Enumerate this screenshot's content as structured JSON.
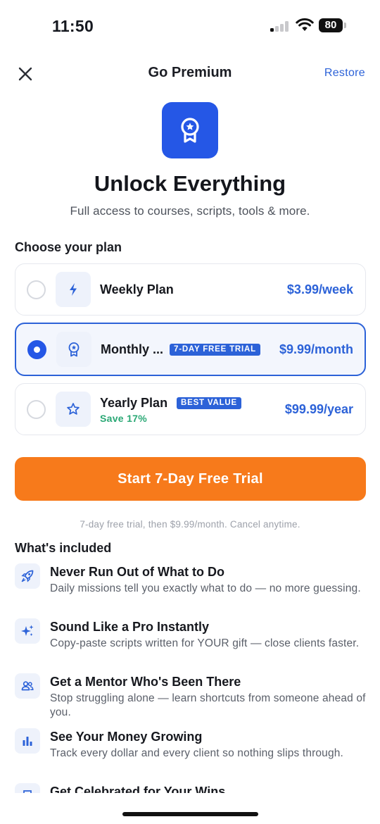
{
  "status_bar": {
    "time": "11:50",
    "battery": "80"
  },
  "header": {
    "title": "Go Premium",
    "restore_label": "Restore",
    "close_icon": "close-icon"
  },
  "hero": {
    "icon": "award-badge-icon",
    "title": "Unlock Everything",
    "subtitle": "Full access to courses, scripts, tools & more."
  },
  "plans_section": {
    "label": "Choose your plan",
    "plans": [
      {
        "name": "Weekly Plan",
        "price": "$3.99/week",
        "icon": "bolt-icon",
        "selected": false
      },
      {
        "name": "Monthly ...",
        "price": "$9.99/month",
        "icon": "award-icon",
        "badge": "7-DAY FREE TRIAL",
        "selected": true
      },
      {
        "name": "Yearly Plan",
        "price": "$99.99/year",
        "icon": "star-icon",
        "badge": "BEST VALUE",
        "note": "Save 17%",
        "selected": false
      }
    ]
  },
  "cta": {
    "label": "Start 7-Day Free Trial",
    "disclaimer": "7-day free trial, then $9.99/month. Cancel anytime."
  },
  "features_section": {
    "label": "What's included",
    "items": [
      {
        "icon": "rocket-icon",
        "title": "Never Run Out of What to Do",
        "desc": "Daily missions tell you exactly what to do — no more guessing."
      },
      {
        "icon": "sparkles-icon",
        "title": "Sound Like a Pro Instantly",
        "desc": "Copy-paste scripts written for YOUR gift — close clients faster."
      },
      {
        "icon": "users-icon",
        "title": "Get a Mentor Who's Been There",
        "desc": "Stop struggling alone — learn shortcuts from someone ahead of you."
      },
      {
        "icon": "bar-chart-icon",
        "title": "See Your Money Growing",
        "desc": "Track every dollar and every client so nothing slips through."
      },
      {
        "icon": "trophy-icon",
        "title": "Get Celebrated for Your Wins",
        "desc": ""
      }
    ]
  },
  "colors": {
    "accent": "#2c62d8",
    "cta": "#f77a1b",
    "success": "#2aa875"
  }
}
